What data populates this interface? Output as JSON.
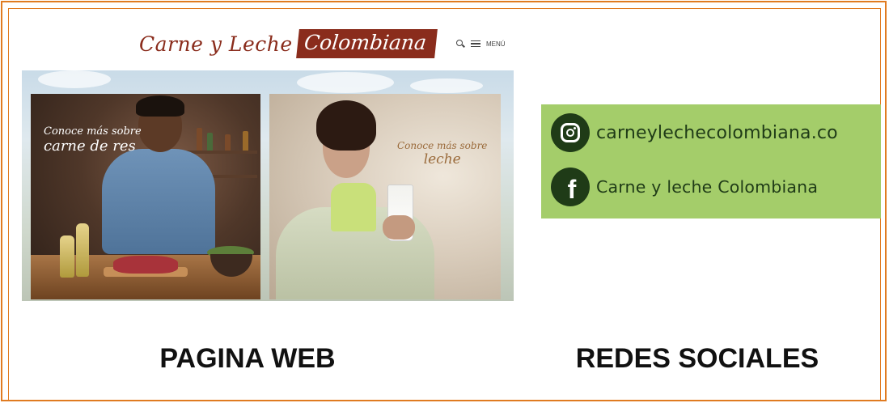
{
  "website": {
    "logo_text": "Carne y Leche",
    "logo_badge": "Colombiana",
    "menu_label": "MENÚ",
    "left_panel": {
      "line1": "Conoce más sobre",
      "line2": "carne de res"
    },
    "right_panel": {
      "line1": "Conoce más sobre",
      "line2": "leche"
    }
  },
  "social": {
    "instagram_handle": "carneylechecolombiana.co",
    "facebook_name": "Carne y leche Colombiana",
    "card_color": "#a4cd6a",
    "icon_color": "#1f3b17"
  },
  "labels": {
    "web": "PAGINA WEB",
    "social": "REDES SOCIALES"
  },
  "colors": {
    "frame": "#e07b21",
    "brand": "#8a2c1c"
  }
}
